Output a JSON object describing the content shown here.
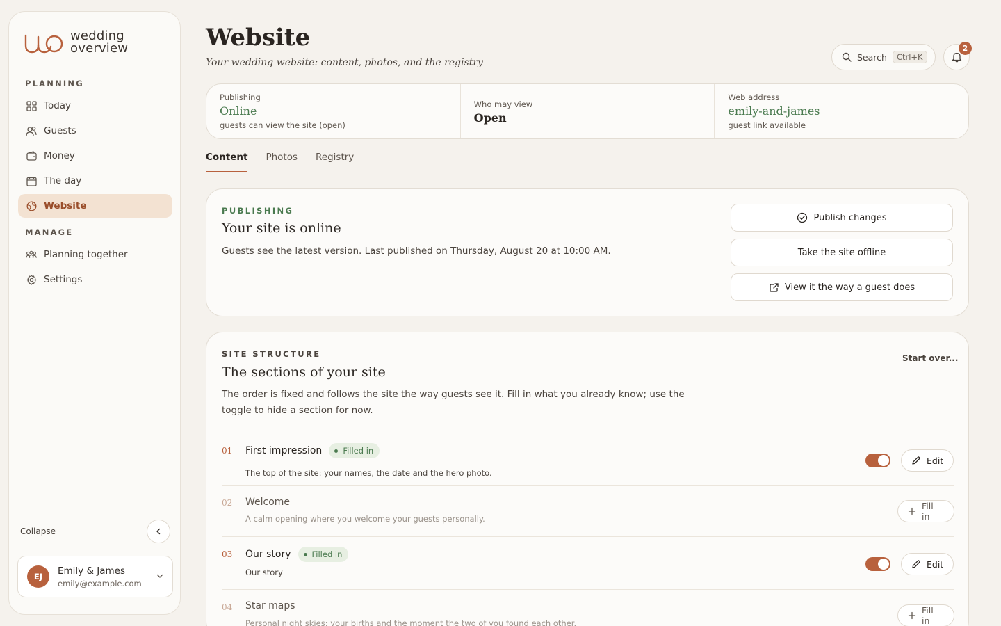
{
  "brand": {
    "line1": "wedding",
    "line2": "overview"
  },
  "sidebar": {
    "planning_heading": "PLANNING",
    "manage_heading": "MANAGE",
    "items": [
      {
        "label": "Today",
        "icon": "grid-icon"
      },
      {
        "label": "Guests",
        "icon": "users-icon"
      },
      {
        "label": "Money",
        "icon": "wallet-icon"
      },
      {
        "label": "The day",
        "icon": "calendar-icon"
      },
      {
        "label": "Website",
        "icon": "globe-icon",
        "active": true
      }
    ],
    "manage_items": [
      {
        "label": "Planning together",
        "icon": "group-icon"
      },
      {
        "label": "Settings",
        "icon": "gear-icon"
      }
    ],
    "collapse_label": "Collapse",
    "user": {
      "initials": "EJ",
      "name": "Emily & James",
      "email": "emily@example.com"
    }
  },
  "header": {
    "title": "Website",
    "subtitle": "Your wedding website: content, photos, and the registry",
    "search_label": "Search",
    "search_shortcut": "Ctrl+K",
    "notification_count": "2"
  },
  "stats": [
    {
      "label": "Publishing",
      "value": "Online",
      "note": "guests can view the site (open)"
    },
    {
      "label": "Who may view",
      "value": "Open",
      "note": ""
    },
    {
      "label": "Web address",
      "value": "emily-and-james",
      "note": "guest link available"
    }
  ],
  "tabs": [
    "Content",
    "Photos",
    "Registry"
  ],
  "publishing_card": {
    "eyebrow": "PUBLISHING",
    "title": "Your site is online",
    "text": "Guests see the latest version. Last published on Thursday, August 20 at 10:00 AM.",
    "buttons": [
      "Publish changes",
      "Take the site offline",
      "View it the way a guest does"
    ]
  },
  "structure_card": {
    "eyebrow": "SITE STRUCTURE",
    "title": "The sections of your site",
    "text": "The order is fixed and follows the site the way guests see it. Fill in what you already know; use the toggle to hide a section for now.",
    "start_over": "Start over...",
    "filled_label": "Filled in",
    "edit_label": "Edit",
    "fill_label": "Fill in",
    "sections": [
      {
        "num": "01",
        "title": "First impression",
        "desc": "The top of the site: your names, the date and the hero photo.",
        "filled": true
      },
      {
        "num": "02",
        "title": "Welcome",
        "desc": "A calm opening where you welcome your guests personally.",
        "filled": false
      },
      {
        "num": "03",
        "title": "Our story",
        "desc": "Our story",
        "filled": true
      },
      {
        "num": "04",
        "title": "Star maps",
        "desc": "Personal night skies: your births and the moment the two of you found each other.",
        "filled": false
      }
    ]
  },
  "colors": {
    "accent": "#b8613d",
    "green": "#4a7a4f",
    "background": "#f5f2ed"
  }
}
